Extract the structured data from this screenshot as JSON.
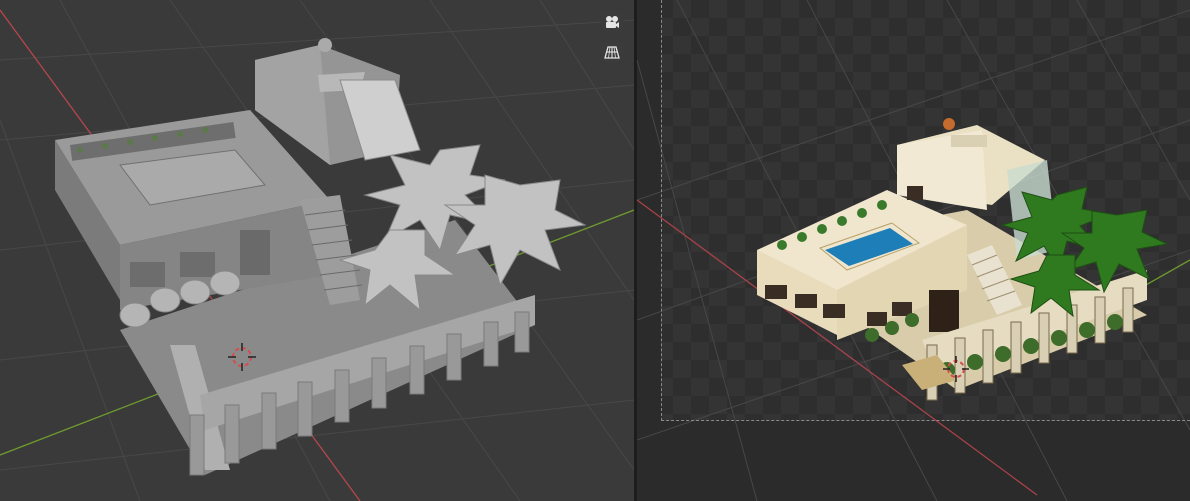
{
  "viewport_left": {
    "mode": "solid",
    "buttons": [
      {
        "name": "camera-view-icon"
      },
      {
        "name": "grid-ortho-toggle-icon"
      }
    ]
  },
  "viewport_right": {
    "mode": "rendered",
    "has_camera_frame": true
  },
  "colors": {
    "x_axis": "#c4424b",
    "y_axis": "#6f9a2e",
    "grid": "#4a4a4a",
    "viewport_bg": "#3a3a3a",
    "pool": "#1e7fb8",
    "palm": "#2f7a1f"
  }
}
